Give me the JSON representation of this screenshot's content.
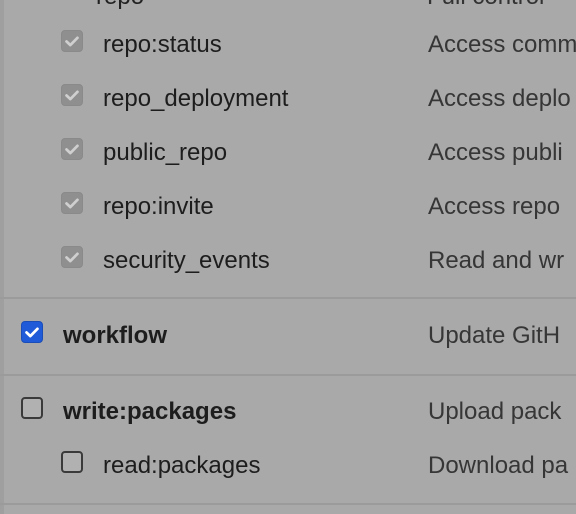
{
  "header_partial": {
    "scope": "repo",
    "desc": "Full control"
  },
  "scopes": [
    {
      "id": "repo-status",
      "label": "repo:status",
      "desc": "Access comm",
      "checked": true,
      "disabled": true,
      "bold": false
    },
    {
      "id": "repo-deployment",
      "label": "repo_deployment",
      "desc": "Access deplo",
      "checked": true,
      "disabled": true,
      "bold": false
    },
    {
      "id": "public-repo",
      "label": "public_repo",
      "desc": "Access publi",
      "checked": true,
      "disabled": true,
      "bold": false
    },
    {
      "id": "repo-invite",
      "label": "repo:invite",
      "desc": "Access repo",
      "checked": true,
      "disabled": true,
      "bold": false
    },
    {
      "id": "security-events",
      "label": "security_events",
      "desc": "Read and wr",
      "checked": true,
      "disabled": true,
      "bold": false
    },
    {
      "id": "workflow",
      "label": "workflow",
      "desc": "Update GitH",
      "checked": true,
      "disabled": false,
      "bold": true
    },
    {
      "id": "write-packages",
      "label": "write:packages",
      "desc": "Upload pack",
      "checked": false,
      "disabled": false,
      "bold": true
    },
    {
      "id": "read-packages",
      "label": "read:packages",
      "desc": "Download pa",
      "checked": false,
      "disabled": false,
      "bold": false
    }
  ],
  "colors": {
    "checked_blue": "#1f5bd8",
    "disabled_gray": "#8f8f8f",
    "background": "#a9a9a9"
  }
}
